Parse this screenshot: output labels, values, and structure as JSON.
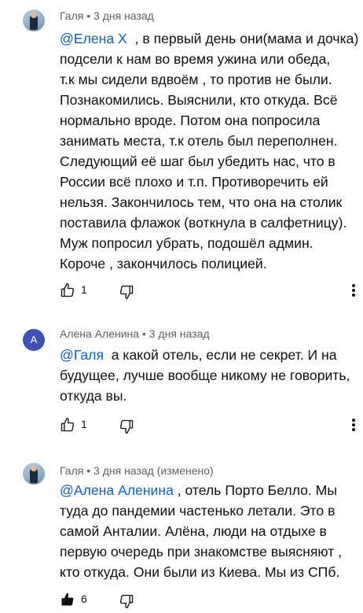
{
  "comments": [
    {
      "author": "Галя",
      "time": "3 дня назад",
      "edited": "",
      "avatar_letter": "",
      "mention": "@Елена Х",
      "lines": [
        "  , в первый день они(мама и дочка)",
        "подсели к нам во время ужина или обеда,",
        "т.к мы сидели вдвоём , то против не были.",
        "Познакомились. Выяснили, кто откуда. Всё",
        "нормально вроде. Потом она попросила",
        "занимать места, т.к отель был переполнен.",
        "Следующий её шаг был убедить нас, что в",
        "России всё плохо и т.п. Противоречить ей",
        "нельзя. Закончилось тем, что она на столик",
        "поставила флажок (воткнула в салфетницу).",
        "Муж попросил убрать, подошёл админ.",
        "Короче , закончилось полицией."
      ],
      "likes": "1",
      "liked": false
    },
    {
      "author": "Алена Аленина",
      "time": "3 дня назад",
      "edited": "",
      "avatar_letter": "А",
      "mention": "@Галя",
      "lines": [
        "  а какой отель, если не секрет. И на",
        "будущее, лучше вообще никому не говорить,",
        "откуда вы."
      ],
      "likes": "1",
      "liked": false
    },
    {
      "author": "Галя",
      "time": "3 дня назад",
      "edited": "(изменено)",
      "avatar_letter": "",
      "mention": "@Алена Аленина",
      "lines": [
        " , отель Порто Белло. Мы",
        "туда до пандемии частенько летали. Это в",
        "самой Анталии. Алёна, люди на отдыхе в",
        "первую очередь при знакомстве выясняют ,",
        "кто откуда. Они были из Киева. Мы из СПб."
      ],
      "likes": "6",
      "liked": true
    }
  ],
  "icons": {
    "like": "thumbs-up-icon",
    "dislike": "thumbs-down-icon",
    "more": "more-vertical-icon"
  },
  "colors": {
    "mention": "#065fd4",
    "meta": "#606060",
    "avatar_letter_bg": "#3f51b5"
  }
}
